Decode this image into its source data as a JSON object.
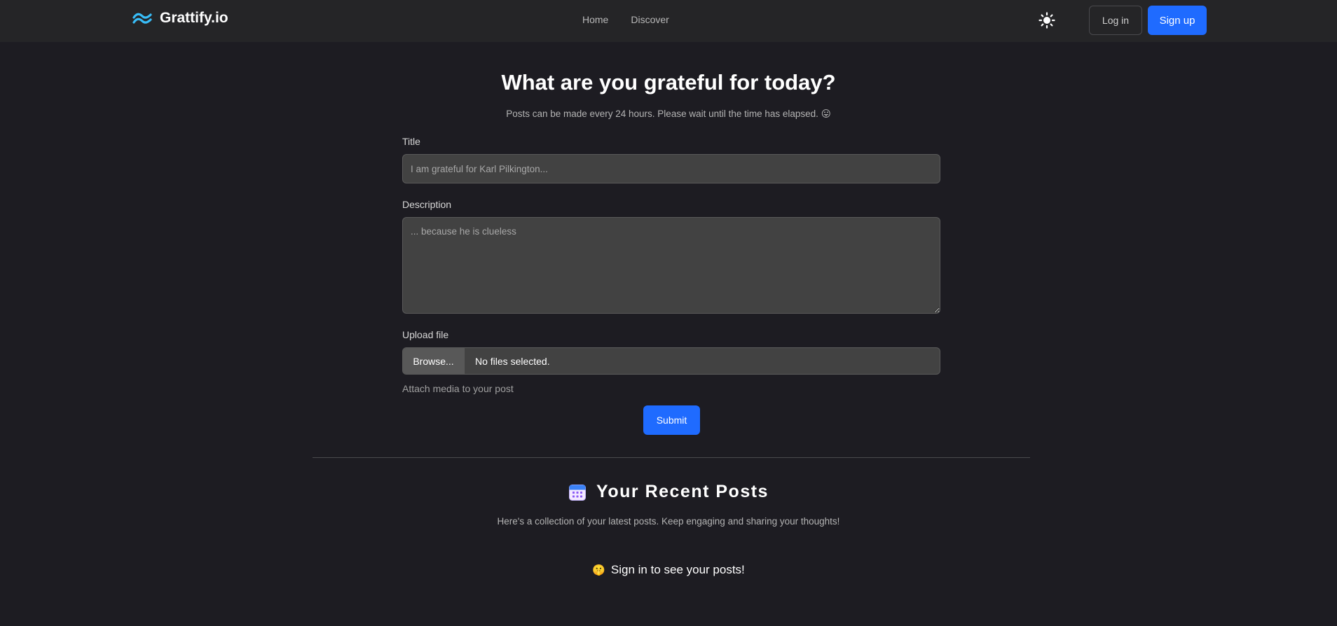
{
  "navbar": {
    "brand_name": "Grattify.io",
    "links": [
      {
        "label": "Home"
      },
      {
        "label": "Discover"
      }
    ],
    "theme_icon": "sun-icon",
    "login_label": "Log in",
    "signup_label": "Sign up"
  },
  "main": {
    "headline": "What are you grateful for today?",
    "subnote_text": "Posts can be made every 24 hours. Please wait until the time has elapsed.",
    "subnote_emoji": "😛",
    "title_label": "Title",
    "title_placeholder": "I am grateful for Karl Pilkington...",
    "title_value": "",
    "description_label": "Description",
    "description_placeholder": "... because he is clueless",
    "description_value": "",
    "upload_label": "Upload file",
    "browse_label": "Browse...",
    "file_status": "No files selected.",
    "upload_help": "Attach media to your post",
    "submit_label": "Submit"
  },
  "recent": {
    "icon": "calendar-icon",
    "title": "Your Recent Posts",
    "subtitle": "Here's a collection of your latest posts. Keep engaging and sharing your thoughts!",
    "signin_emoji": "🤫",
    "signin_text": "Sign in to see your posts!"
  },
  "colors": {
    "accent": "#1f6bff",
    "background": "#1d1c22",
    "navbar": "#252527",
    "input": "#424242",
    "brand_logo": "#38bdf8"
  }
}
